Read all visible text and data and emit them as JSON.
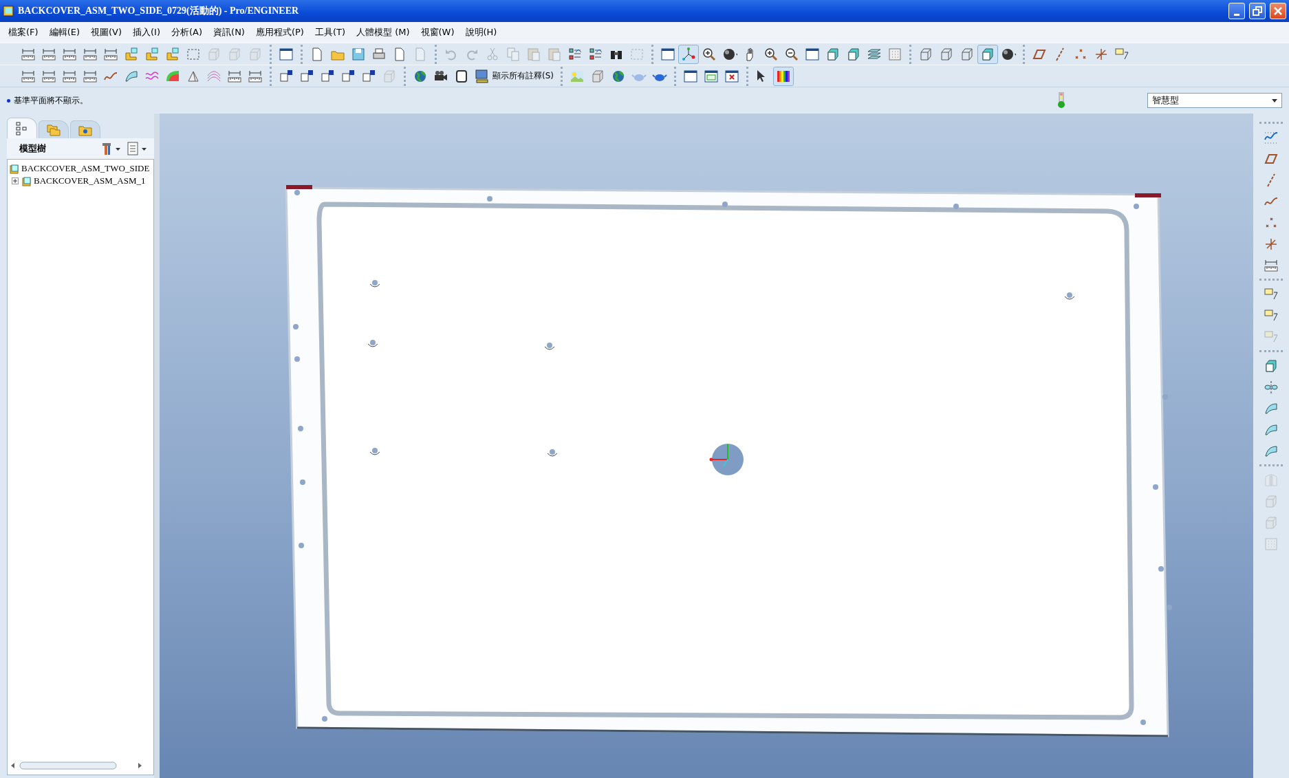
{
  "window": {
    "title": "BACKCOVER_ASM_TWO_SIDE_0729(活動的) - Pro/ENGINEER"
  },
  "menu": [
    "檔案(F)",
    "編輯(E)",
    "視圖(V)",
    "插入(I)",
    "分析(A)",
    "資訊(N)",
    "應用程式(P)",
    "工具(T)",
    "人體模型 (M)",
    "視窗(W)",
    "說明(H)"
  ],
  "toolbar_rows": [
    [
      [
        {
          "disabled": false,
          "pressed": false
        },
        {
          "disabled": false,
          "pressed": false
        },
        {
          "disabled": false,
          "pressed": false
        },
        {
          "disabled": false,
          "pressed": false
        },
        {
          "disabled": false,
          "pressed": false
        },
        {
          "disabled": false,
          "pressed": false
        },
        {
          "disabled": false,
          "pressed": false
        },
        {
          "disabled": false,
          "pressed": false
        },
        {
          "disabled": false,
          "pressed": false
        },
        {
          "disabled": true,
          "pressed": false
        },
        {
          "disabled": true,
          "pressed": false
        },
        {
          "disabled": true,
          "pressed": false
        }
      ],
      [
        {
          "disabled": false,
          "pressed": false
        }
      ],
      [
        {
          "disabled": false,
          "pressed": false
        },
        {
          "disabled": false,
          "pressed": false
        },
        {
          "disabled": false,
          "pressed": false
        },
        {
          "disabled": false,
          "pressed": false
        },
        {
          "disabled": false,
          "pressed": false
        },
        {
          "disabled": true,
          "pressed": false
        }
      ],
      [
        {
          "disabled": true,
          "pressed": false
        },
        {
          "disabled": true,
          "pressed": false
        },
        {
          "disabled": true,
          "pressed": false
        },
        {
          "disabled": true,
          "pressed": false
        },
        {
          "disabled": true,
          "pressed": false
        },
        {
          "disabled": true,
          "pressed": false
        },
        {
          "disabled": false,
          "pressed": false
        },
        {
          "disabled": false,
          "pressed": false
        },
        {
          "disabled": false,
          "pressed": false
        },
        {
          "disabled": true,
          "pressed": false
        }
      ],
      [
        {
          "disabled": false,
          "pressed": false
        },
        {
          "disabled": false,
          "pressed": true
        },
        {
          "disabled": false,
          "pressed": false
        },
        {
          "disabled": false,
          "pressed": false
        },
        {
          "disabled": false,
          "pressed": false
        },
        {
          "disabled": false,
          "pressed": false
        },
        {
          "disabled": false,
          "pressed": false
        },
        {
          "disabled": false,
          "pressed": false
        },
        {
          "disabled": false,
          "pressed": false
        },
        {
          "disabled": false,
          "pressed": false
        },
        {
          "disabled": false,
          "pressed": false
        },
        {
          "disabled": false,
          "pressed": false
        }
      ],
      [
        {
          "disabled": false,
          "pressed": false
        },
        {
          "disabled": false,
          "pressed": false
        },
        {
          "disabled": false,
          "pressed": false
        },
        {
          "disabled": false,
          "pressed": true
        },
        {
          "disabled": false,
          "pressed": false
        }
      ],
      [
        {
          "disabled": false,
          "pressed": false
        },
        {
          "disabled": false,
          "pressed": false
        },
        {
          "disabled": false,
          "pressed": false
        },
        {
          "disabled": false,
          "pressed": false
        },
        {
          "disabled": false,
          "pressed": false
        }
      ]
    ],
    [
      [
        {
          "disabled": false,
          "pressed": false
        },
        {
          "disabled": false,
          "pressed": false
        },
        {
          "disabled": false,
          "pressed": false
        },
        {
          "disabled": false,
          "pressed": false
        },
        {
          "disabled": false,
          "pressed": false
        },
        {
          "disabled": false,
          "pressed": false
        },
        {
          "disabled": false,
          "pressed": false
        },
        {
          "disabled": false,
          "pressed": false
        },
        {
          "disabled": false,
          "pressed": false
        },
        {
          "disabled": false,
          "pressed": false
        },
        {
          "disabled": false,
          "pressed": false
        },
        {
          "disabled": false,
          "pressed": false
        }
      ],
      [
        {
          "disabled": false,
          "pressed": false
        },
        {
          "disabled": false,
          "pressed": false
        },
        {
          "disabled": false,
          "pressed": false
        },
        {
          "disabled": false,
          "pressed": false
        },
        {
          "disabled": false,
          "pressed": false
        },
        {
          "disabled": true,
          "pressed": false
        }
      ],
      [
        {
          "disabled": false,
          "pressed": false
        },
        {
          "disabled": false,
          "pressed": false
        },
        {
          "disabled": false,
          "pressed": false
        },
        {
          "disabled": false,
          "pressed": false,
          "label": "顯示所有註釋(S)"
        }
      ],
      [
        {
          "disabled": false,
          "pressed": false
        },
        {
          "disabled": false,
          "pressed": false
        },
        {
          "disabled": false,
          "pressed": false
        },
        {
          "disabled": true,
          "pressed": false
        },
        {
          "disabled": false,
          "pressed": false
        }
      ],
      [
        {
          "disabled": false,
          "pressed": false
        },
        {
          "disabled": false,
          "pressed": false
        },
        {
          "disabled": false,
          "pressed": false
        }
      ],
      [
        {
          "disabled": false,
          "pressed": false
        },
        {
          "disabled": false,
          "pressed": true
        }
      ]
    ]
  ],
  "status": {
    "message": "基準平面將不顯示。",
    "filter": "智慧型"
  },
  "left_panel": {
    "tabs": [
      {
        "selected": true
      },
      {
        "selected": false
      },
      {
        "selected": false
      }
    ],
    "title": "模型樹",
    "tree": [
      {
        "label": "BACKCOVER_ASM_TWO_SIDE",
        "children": [
          {
            "label": "BACKCOVER_ASM_ASM_1",
            "expanded": false
          }
        ]
      }
    ]
  },
  "right_toolbar": [
    [
      {
        "disabled": false
      },
      {
        "disabled": false
      },
      {
        "disabled": false
      },
      {
        "disabled": false
      },
      {
        "disabled": false
      },
      {
        "disabled": false
      },
      {
        "disabled": false
      }
    ],
    [
      {
        "disabled": false
      },
      {
        "disabled": false
      },
      {
        "disabled": true
      }
    ],
    [
      {
        "disabled": false
      },
      {
        "disabled": false
      },
      {
        "disabled": false
      },
      {
        "disabled": false
      },
      {
        "disabled": false
      }
    ],
    [
      {
        "disabled": true
      },
      {
        "disabled": true
      },
      {
        "disabled": true
      },
      {
        "disabled": true
      }
    ]
  ]
}
